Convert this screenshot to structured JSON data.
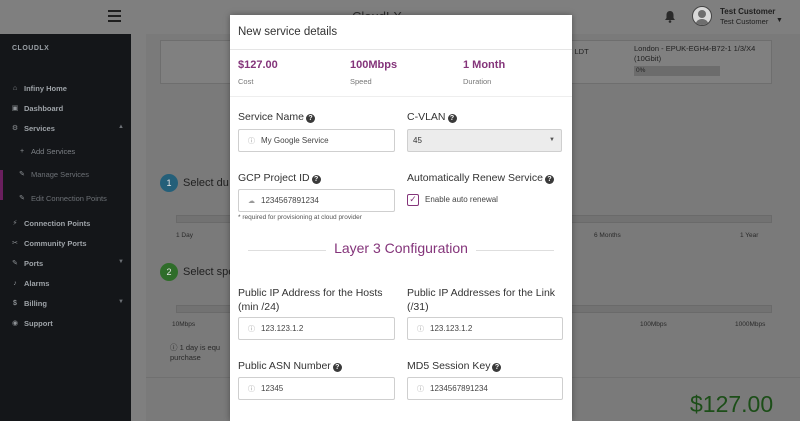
{
  "topbar": {
    "brand": "CloudLX",
    "user_name": "Test Customer",
    "user_sub": "Test Customer"
  },
  "sidebar": {
    "brand": "CLOUDLX",
    "items": [
      {
        "label": "Infiny Home",
        "icon": "home-icon"
      },
      {
        "label": "Dashboard",
        "icon": "dashboard-icon"
      },
      {
        "label": "Services",
        "icon": "cogs-icon"
      },
      {
        "label": "Add Services",
        "icon": "plus-icon"
      },
      {
        "label": "Manage Services",
        "icon": "wrench-icon"
      },
      {
        "label": "Edit Connection Points",
        "icon": "wrench-icon"
      },
      {
        "label": "Connection Points",
        "icon": "plug-icon"
      },
      {
        "label": "Community Ports",
        "icon": "tools-icon"
      },
      {
        "label": "Ports",
        "icon": "wrench-icon"
      },
      {
        "label": "Alarms",
        "icon": "bell-icon"
      },
      {
        "label": "Billing",
        "icon": "dollar-icon"
      },
      {
        "label": "Support",
        "icon": "globe-icon"
      }
    ]
  },
  "background": {
    "table_cell_1": "ix LDT",
    "table_cell_2": "London - EPUK-EGH4-B72-1 1/3/X4 (10Gbit)",
    "table_progress": "0%",
    "step1_num": "1",
    "step1_text": "Select du",
    "step2_num": "2",
    "step2_text": "Select spe",
    "duration_ticks": [
      "1 Day",
      "6 Months",
      "1 Year"
    ],
    "speed_ticks": [
      "10Mbps",
      "100Mbps",
      "1000Mbps"
    ],
    "note": "1 day is equ purchase",
    "total_price": "$127.00"
  },
  "modal": {
    "title": "New service details",
    "stats": [
      {
        "value": "$127.00",
        "label": "Cost"
      },
      {
        "value": "100Mbps",
        "label": "Speed"
      },
      {
        "value": "1 Month",
        "label": "Duration"
      }
    ],
    "service_name": {
      "label": "Service Name",
      "value": "My Google Service"
    },
    "cvlan": {
      "label": "C-VLAN",
      "value": "45"
    },
    "gcp_project": {
      "label": "GCP Project ID",
      "value": "1234567891234",
      "help": "* required for provisioning at cloud provider"
    },
    "auto_renew": {
      "label": "Automatically Renew Service",
      "checkbox_label": "Enable auto renewal",
      "checked": true
    },
    "section_title": "Layer 3 Configuration",
    "public_ip_hosts": {
      "label": "Public IP Address for the Hosts (min /24)",
      "value": "123.123.1.2"
    },
    "public_ip_link": {
      "label": "Public IP Addresses for the Link (/31)",
      "value": "123.123.1.2"
    },
    "public_asn": {
      "label": "Public ASN Number",
      "value": "12345"
    },
    "md5_key": {
      "label": "MD5 Session Key",
      "value": "1234567891234"
    },
    "accent_color": "#84347a"
  }
}
